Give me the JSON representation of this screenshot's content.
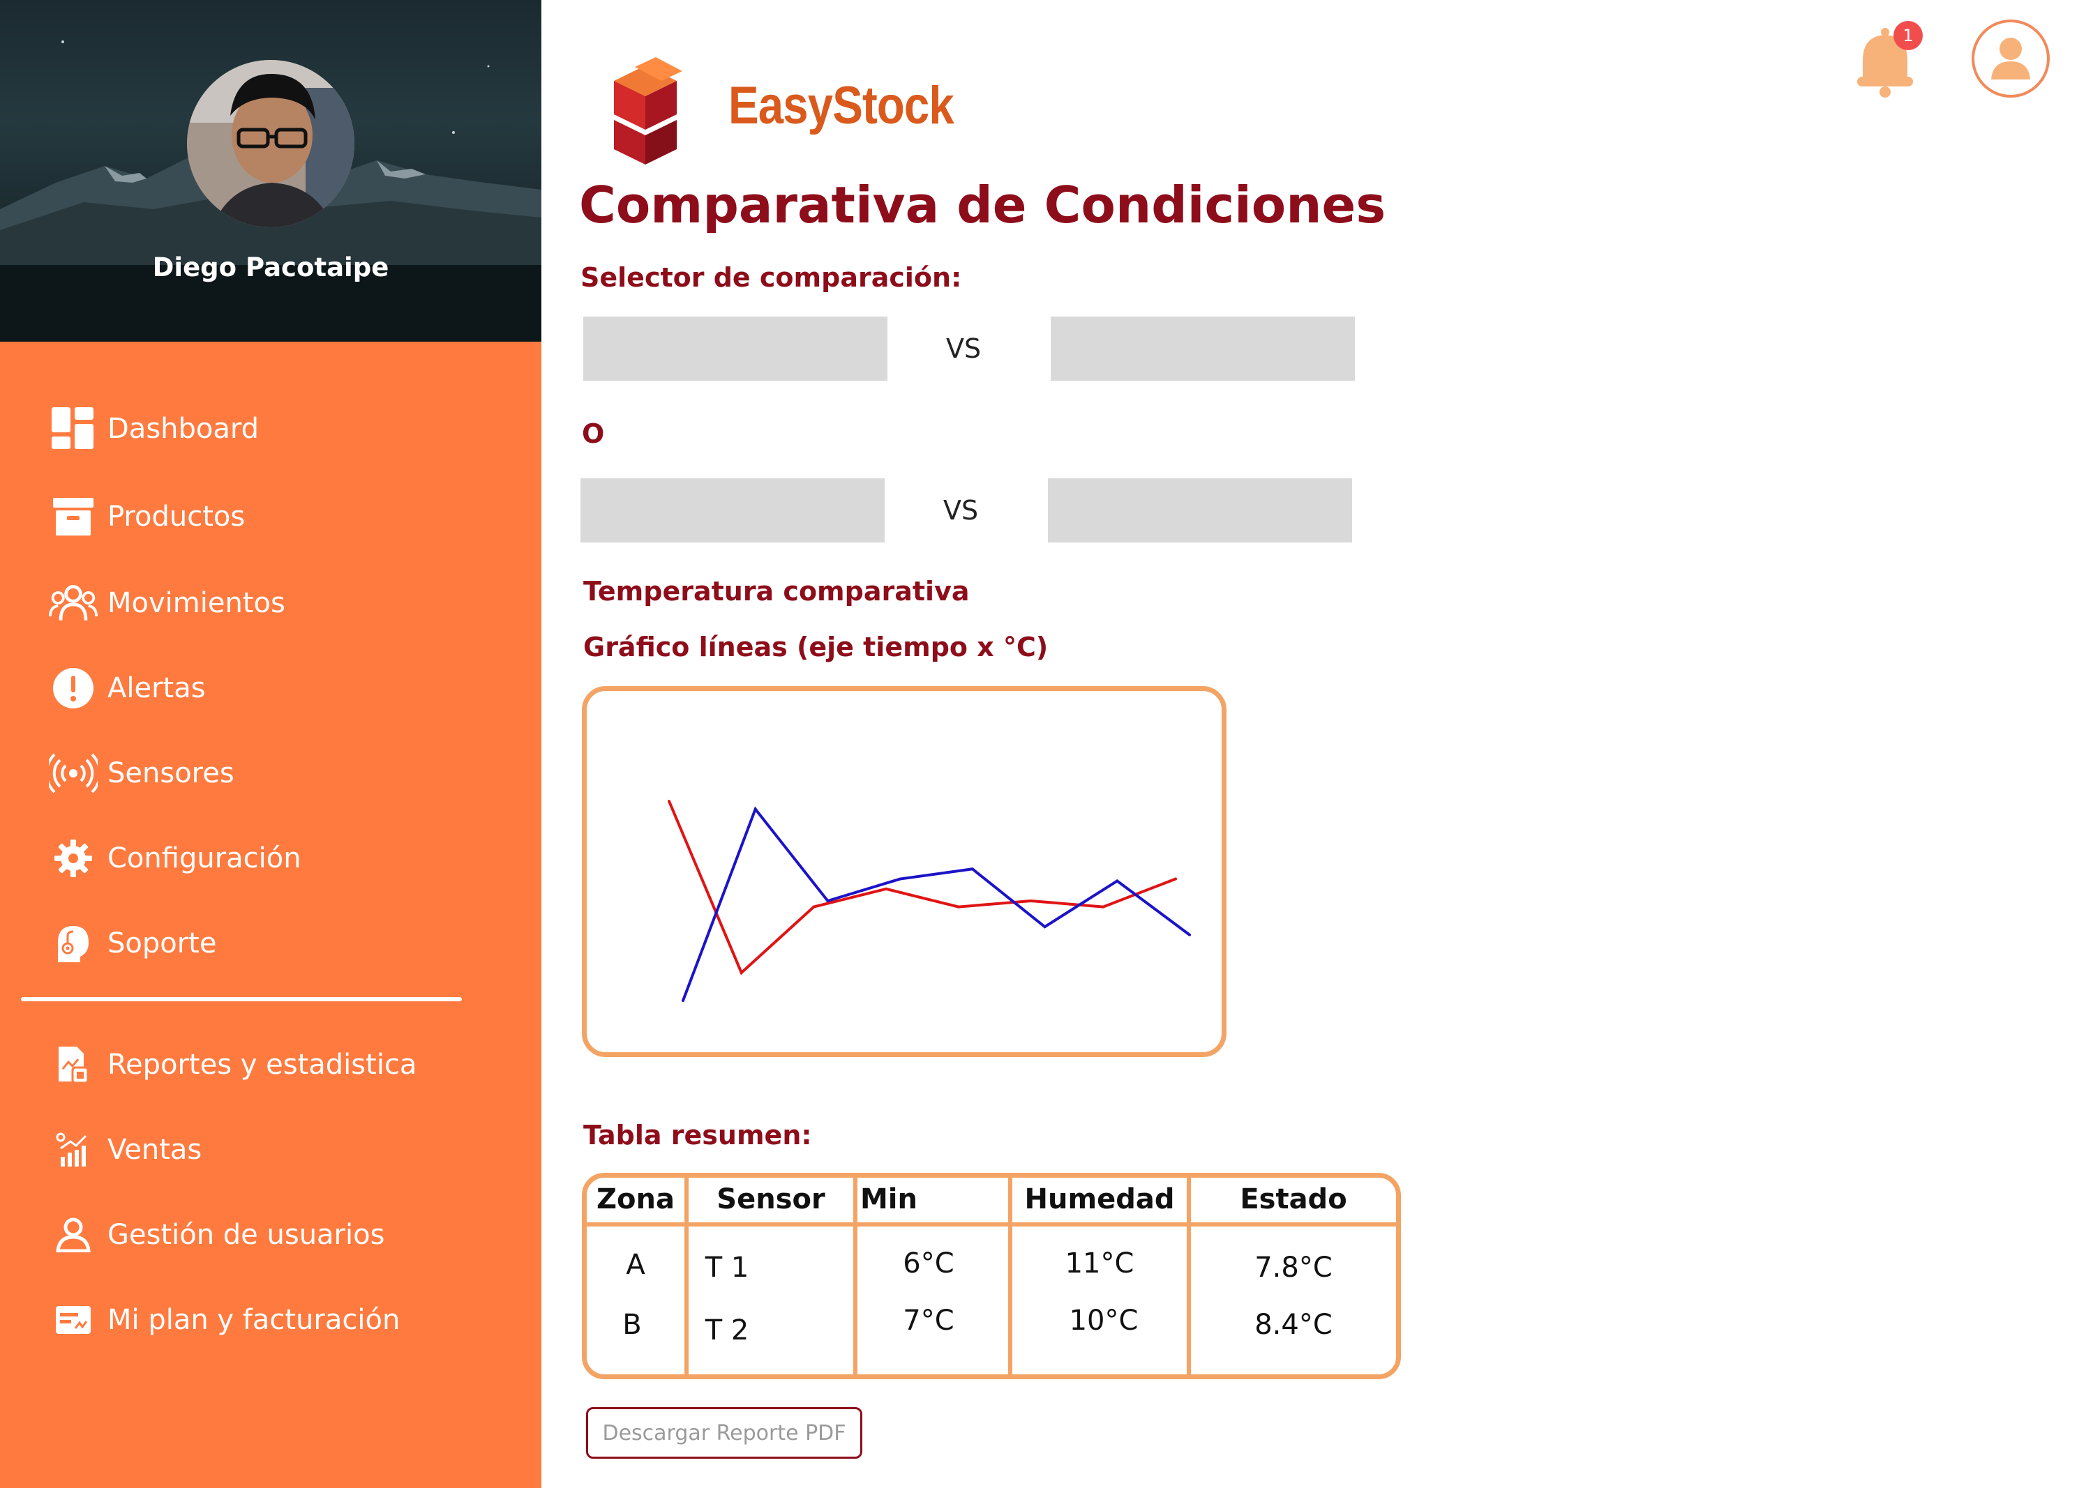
{
  "profile": {
    "name": "Diego Pacotaipe"
  },
  "nav": {
    "items": [
      {
        "label": "Dashboard",
        "icon": "dashboard-icon"
      },
      {
        "label": "Productos",
        "icon": "archive-box-icon"
      },
      {
        "label": "Movimientos",
        "icon": "users-group-icon"
      },
      {
        "label": "Alertas",
        "icon": "alert-icon"
      },
      {
        "label": "Sensores",
        "icon": "sensor-signal-icon"
      },
      {
        "label": "Configuración",
        "icon": "gear-icon"
      },
      {
        "label": "Soporte",
        "icon": "support-headset-icon"
      }
    ],
    "secondary": [
      {
        "label": "Reportes y estadistica",
        "icon": "report-document-icon"
      },
      {
        "label": "Ventas",
        "icon": "sales-chart-icon"
      },
      {
        "label": "Gestión de usuarios",
        "icon": "user-manage-icon"
      },
      {
        "label": "Mi plan y facturación",
        "icon": "billing-card-icon"
      }
    ]
  },
  "brand": {
    "name": "EasyStock"
  },
  "header": {
    "notifications_count": "1"
  },
  "page": {
    "title": "Comparativa de Condiciones",
    "selector_label": "Selector de comparación:",
    "vs_label": "VS",
    "or_label": "O",
    "temp_label": "Temperatura comparativa",
    "chart_label": "Gráfico líneas (eje tiempo x °C)",
    "table_label": "Tabla resumen:",
    "download_button": "Descargar Reporte PDF"
  },
  "table": {
    "headers": [
      "Zona",
      "Sensor",
      "Min",
      "Humedad",
      "Estado"
    ],
    "rows": [
      [
        "A",
        "T 1",
        "6°C",
        "11°C",
        "7.8°C"
      ],
      [
        "B",
        "T 2",
        "7°C",
        "10°C",
        "8.4°C"
      ]
    ]
  },
  "colors": {
    "sidebar": "#ff7a3f",
    "accent": "#8e0d1a",
    "border": "#f3a464",
    "series_red": "#e01414",
    "series_blue": "#1c13c8"
  },
  "chart_data": {
    "type": "line",
    "title": "",
    "xlabel": "",
    "ylabel": "",
    "series": [
      {
        "color": "#e01414",
        "values": [
          1.0,
          0.14,
          0.47,
          0.56,
          0.47,
          0.5,
          0.47,
          0.61
        ]
      },
      {
        "color": "#1c13c8",
        "values": [
          0.0,
          0.96,
          0.5,
          0.61,
          0.66,
          0.37,
          0.6,
          0.33
        ]
      }
    ],
    "x": [
      0,
      1,
      2,
      3,
      4,
      5,
      6,
      7
    ],
    "grid": false
  }
}
